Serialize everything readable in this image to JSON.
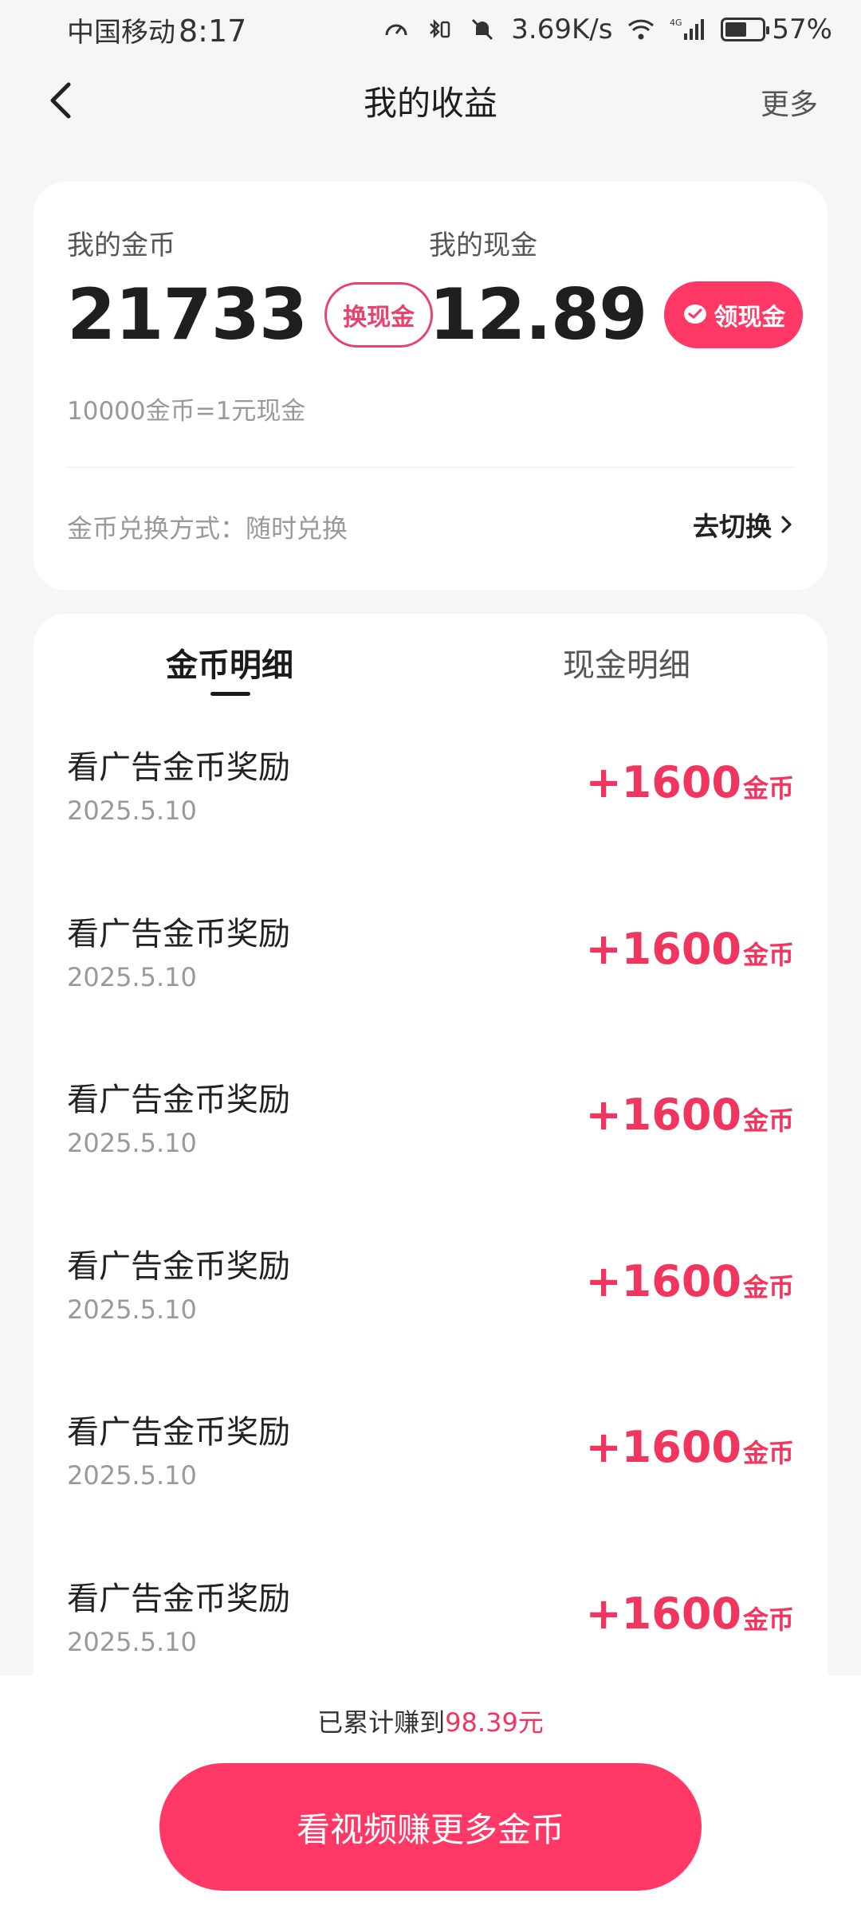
{
  "status_bar": {
    "carrier": "中国移动",
    "time": "8:17",
    "net_speed": "3.69K/s",
    "network": "4G",
    "battery": "57%",
    "battery_level": 0.57
  },
  "header": {
    "title": "我的收益",
    "more_label": "更多"
  },
  "balance": {
    "coins_label": "我的金币",
    "coins_value": "21733",
    "exchange_button": "换现金",
    "cash_label": "我的现金",
    "cash_value": "12.89",
    "withdraw_button": "领现金",
    "rate_text": "10000金币=1元现金",
    "method_text": "金币兑换方式：随时兑换",
    "switch_label": "去切换"
  },
  "tabs": {
    "coins_detail": "金币明细",
    "cash_detail": "现金明细"
  },
  "records": [
    {
      "title": "看广告金币奖励",
      "date": "2025.5.10",
      "amount": "+1600",
      "unit": "金币"
    },
    {
      "title": "看广告金币奖励",
      "date": "2025.5.10",
      "amount": "+1600",
      "unit": "金币"
    },
    {
      "title": "看广告金币奖励",
      "date": "2025.5.10",
      "amount": "+1600",
      "unit": "金币"
    },
    {
      "title": "看广告金币奖励",
      "date": "2025.5.10",
      "amount": "+1600",
      "unit": "金币"
    },
    {
      "title": "看广告金币奖励",
      "date": "2025.5.10",
      "amount": "+1600",
      "unit": "金币"
    },
    {
      "title": "看广告金币奖励",
      "date": "2025.5.10",
      "amount": "+1600",
      "unit": "金币"
    }
  ],
  "footer": {
    "earned_prefix": "已累计赚到",
    "earned_amount": "98.39元",
    "cta_label": "看视频赚更多金币"
  },
  "colors": {
    "accent": "#ff3865",
    "amount_red": "#f0365f",
    "background": "#f6f6f6"
  }
}
